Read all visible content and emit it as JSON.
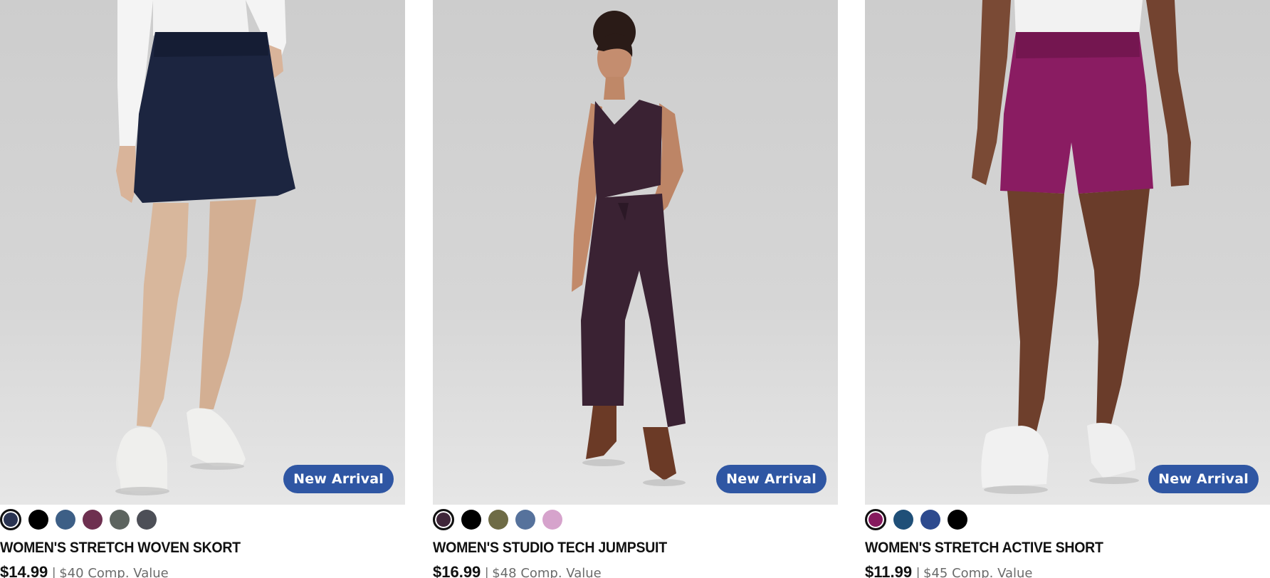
{
  "products": [
    {
      "title": "WOMEN'S STRETCH WOVEN SKORT",
      "price": "$14.99",
      "separator": "|",
      "comp_value": "$40 Comp. Value",
      "badge": "New Arrival",
      "garment_color": "#1c2540",
      "swatches": [
        "#2a3452",
        "#000000",
        "#3d5f86",
        "#6e3050",
        "#5d645f",
        "#4d4f57"
      ],
      "selected_swatch": 0
    },
    {
      "title": "WOMEN'S STUDIO TECH JUMPSUIT",
      "price": "$16.99",
      "separator": "|",
      "comp_value": "$48 Comp. Value",
      "badge": "New Arrival",
      "garment_color": "#3a2233",
      "swatches": [
        "#3f2639",
        "#000000",
        "#6e6b45",
        "#56729c",
        "#d6a3cc"
      ],
      "selected_swatch": 0
    },
    {
      "title": "WOMEN'S STRETCH ACTIVE SHORT",
      "price": "$11.99",
      "separator": "|",
      "comp_value": "$45 Comp. Value",
      "badge": "New Arrival",
      "garment_color": "#8a1c62",
      "swatches": [
        "#86195e",
        "#1f4f78",
        "#2d4a8e",
        "#000000"
      ],
      "selected_swatch": 0
    }
  ],
  "colors": {
    "badge_bg": "#2f56a3",
    "photo_bg": "#cfcfcf"
  }
}
